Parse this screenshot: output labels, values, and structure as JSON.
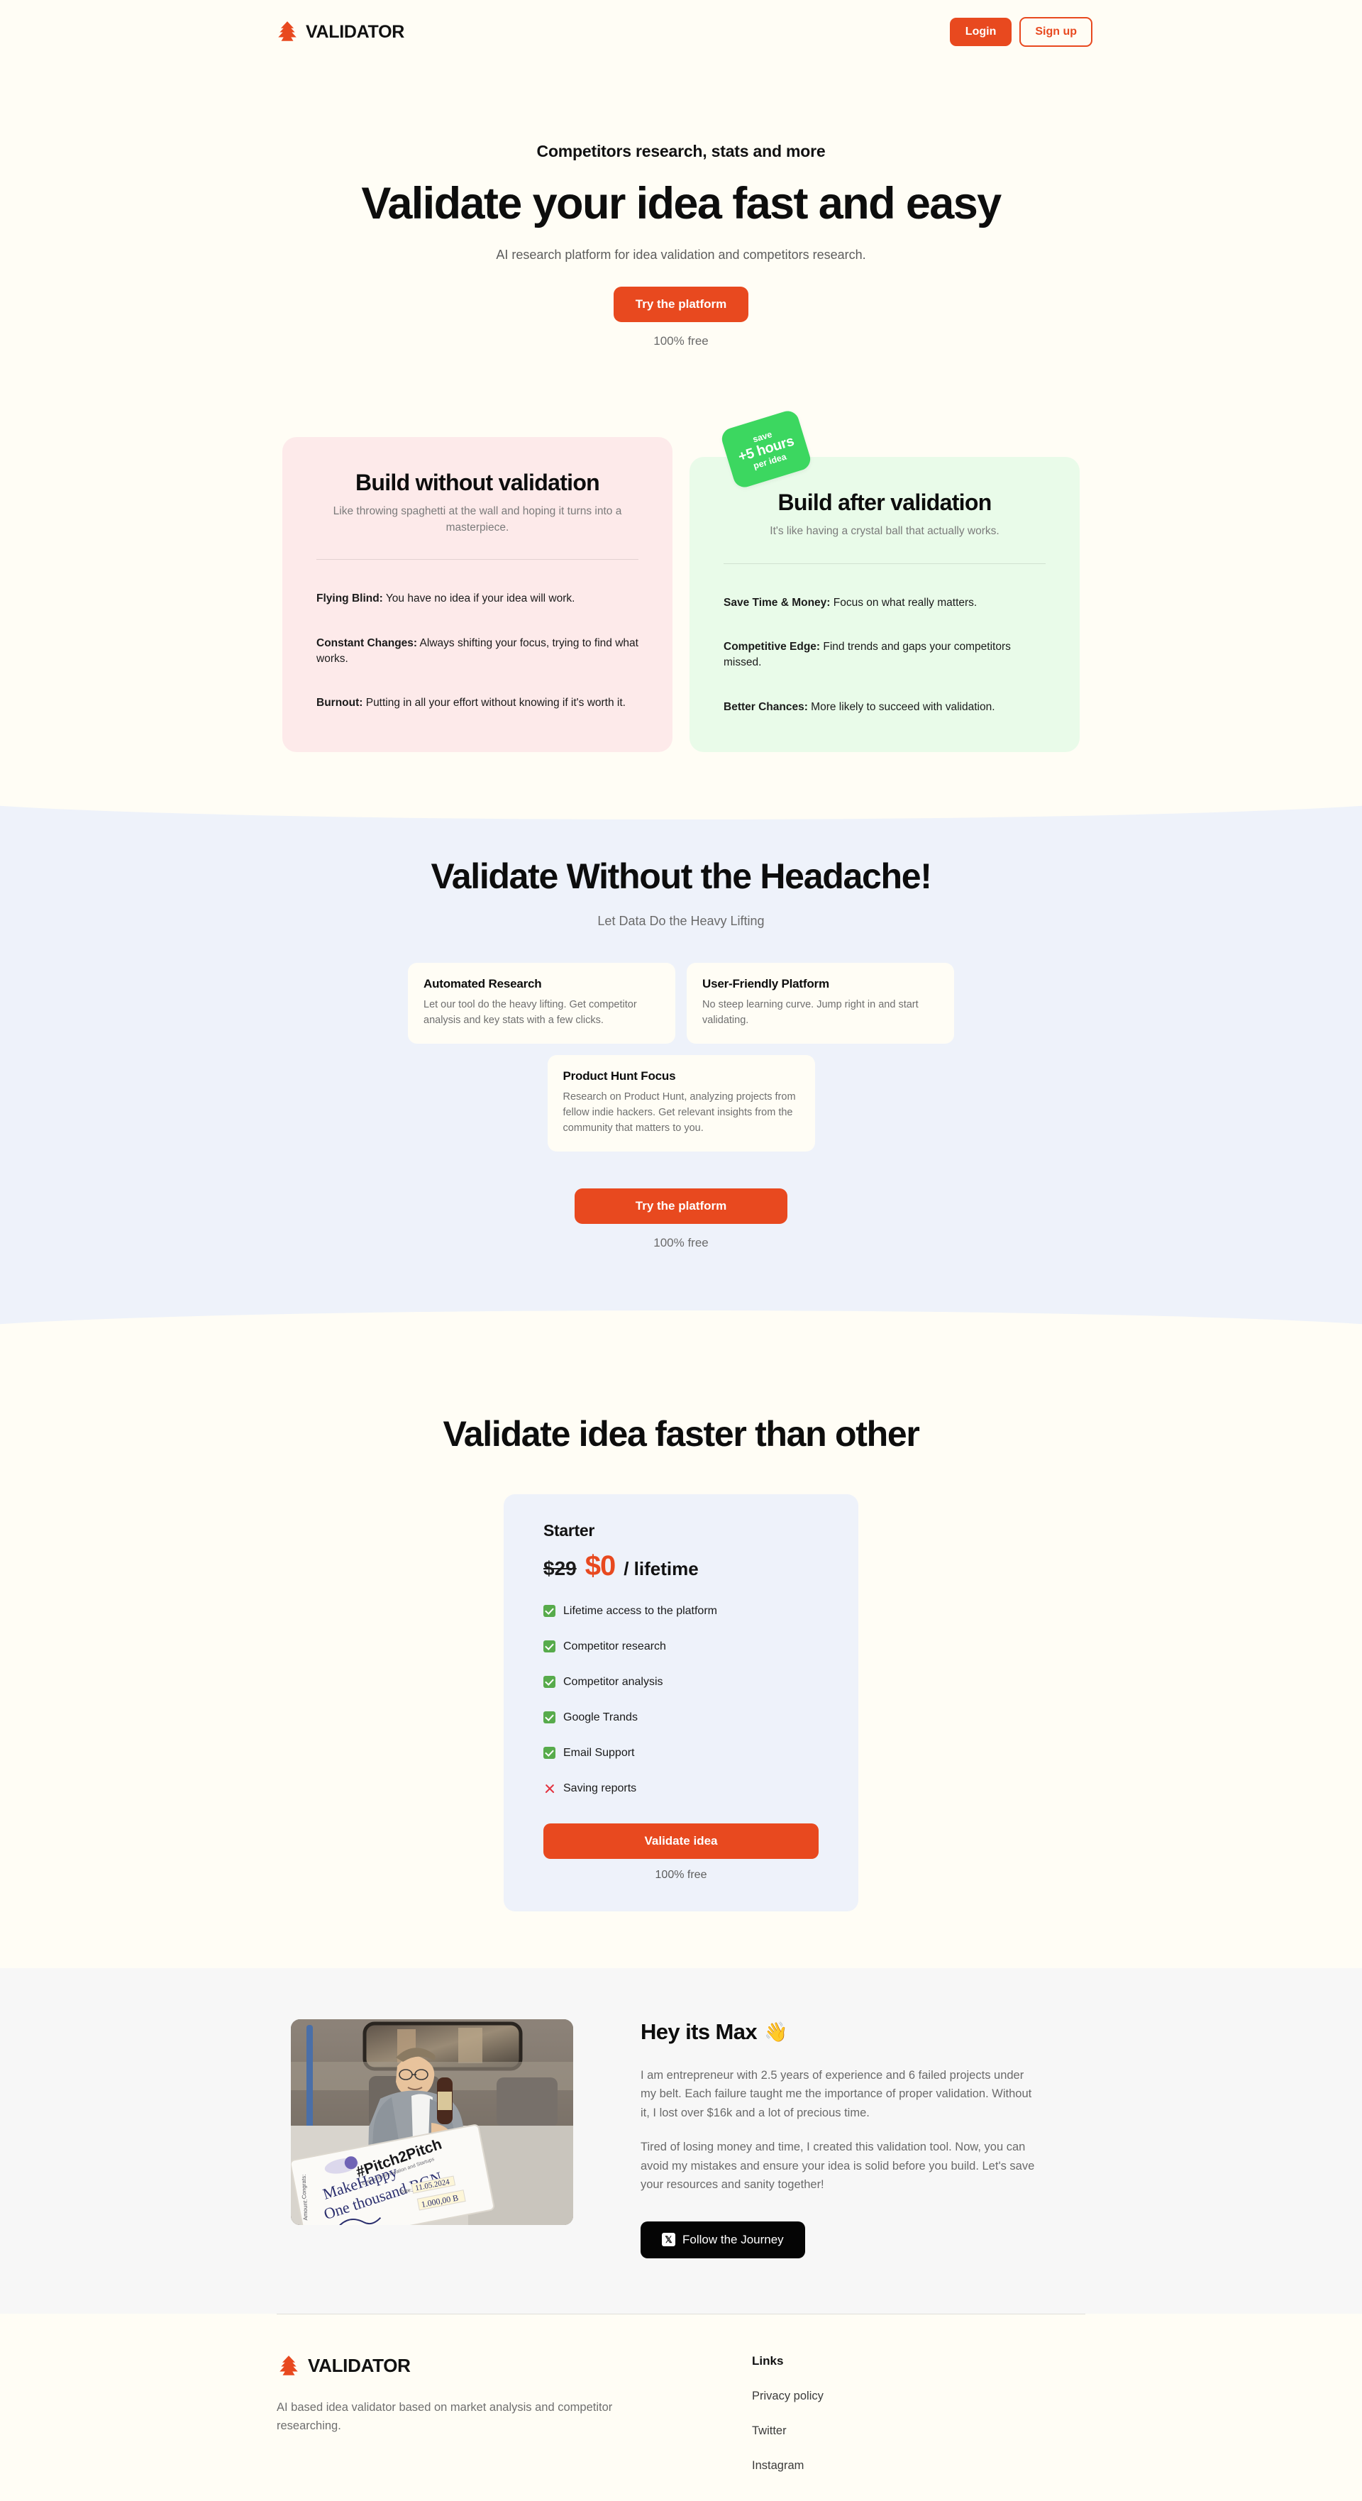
{
  "brand": {
    "name": "VALIDATOR",
    "logo_icon": "pine-tree-icon",
    "accent_color": "#e8491f"
  },
  "header": {
    "login_label": "Login",
    "signup_label": "Sign up"
  },
  "hero": {
    "eyebrow": "Competitors research, stats and more",
    "title": "Validate your idea fast and easy",
    "subtitle": "AI research platform for idea validation and competitors research.",
    "cta_label": "Try the platform",
    "cta_note": "100% free"
  },
  "compare": {
    "badge": {
      "line1": "save",
      "line2": "+5 hours",
      "line3": "per idea",
      "color": "#3cd760"
    },
    "bad": {
      "title": "Build without validation",
      "subtitle": "Like throwing spaghetti at the wall and hoping it turns into a masterpiece.",
      "items": [
        {
          "label": "Flying Blind:",
          "text": " You have no idea if your idea will work."
        },
        {
          "label": "Constant Changes:",
          "text": " Always shifting your focus, trying to find what works."
        },
        {
          "label": "Burnout:",
          "text": " Putting in all your effort without knowing if it's worth it."
        }
      ]
    },
    "good": {
      "title": "Build after validation",
      "subtitle": "It's like having a crystal ball that actually works.",
      "items": [
        {
          "label": "Save Time & Money:",
          "text": " Focus on what really matters."
        },
        {
          "label": "Competitive Edge:",
          "text": " Find trends and gaps your competitors missed."
        },
        {
          "label": "Better Chances:",
          "text": " More likely to succeed with validation."
        }
      ]
    }
  },
  "features": {
    "title": "Validate Without the Headache!",
    "subtitle": "Let Data Do the Heavy Lifting",
    "cards": [
      {
        "title": "Automated Research",
        "desc": "Let our tool do the heavy lifting. Get competitor analysis and key stats with a few clicks."
      },
      {
        "title": "User-Friendly Platform",
        "desc": "No steep learning curve. Jump right in and start validating."
      },
      {
        "title": "Product Hunt Focus",
        "desc": "Research on Product Hunt, analyzing projects from fellow indie hackers. Get relevant insights from the community that matters to you."
      }
    ],
    "cta_label": "Try the platform",
    "cta_note": "100% free"
  },
  "pricing": {
    "title": "Validate idea faster than other",
    "plan": "Starter",
    "old_price": "$29",
    "new_price": "$0",
    "period": "/ lifetime",
    "features": [
      {
        "icon": "check-icon",
        "label": "Lifetime access to the platform",
        "included": true
      },
      {
        "icon": "check-icon",
        "label": "Competitor research",
        "included": true
      },
      {
        "icon": "check-icon",
        "label": "Competitor analysis",
        "included": true
      },
      {
        "icon": "check-icon",
        "label": "Google Trands",
        "included": true
      },
      {
        "icon": "check-icon",
        "label": "Email Support",
        "included": true
      },
      {
        "icon": "cross-icon",
        "label": "Saving reports",
        "included": false
      }
    ],
    "cta_label": "Validate idea",
    "cta_note": "100% free"
  },
  "about": {
    "title": "Hey its Max",
    "wave_icon": "👋",
    "photo_alt": "man-on-train-holding-giant-check-photo",
    "paragraph1": "I am entrepreneur with 2.5 years of experience and 6 failed projects under my belt. Each failure taught me the importance of proper validation. Without it, I lost over $16k and a lot of precious time.",
    "paragraph2": "Tired of losing money and time, I created this validation tool. Now, you can avoid my mistakes and ensure your idea is solid before you build. Let's save your resources and sanity together!",
    "follow_label": "Follow the Journey",
    "follow_icon": "x-twitter-icon"
  },
  "footer": {
    "description": "AI based idea validator based on market analysis and competitor researching.",
    "links_title": "Links",
    "links": [
      "Privacy policy",
      "Twitter",
      "Instagram"
    ]
  }
}
